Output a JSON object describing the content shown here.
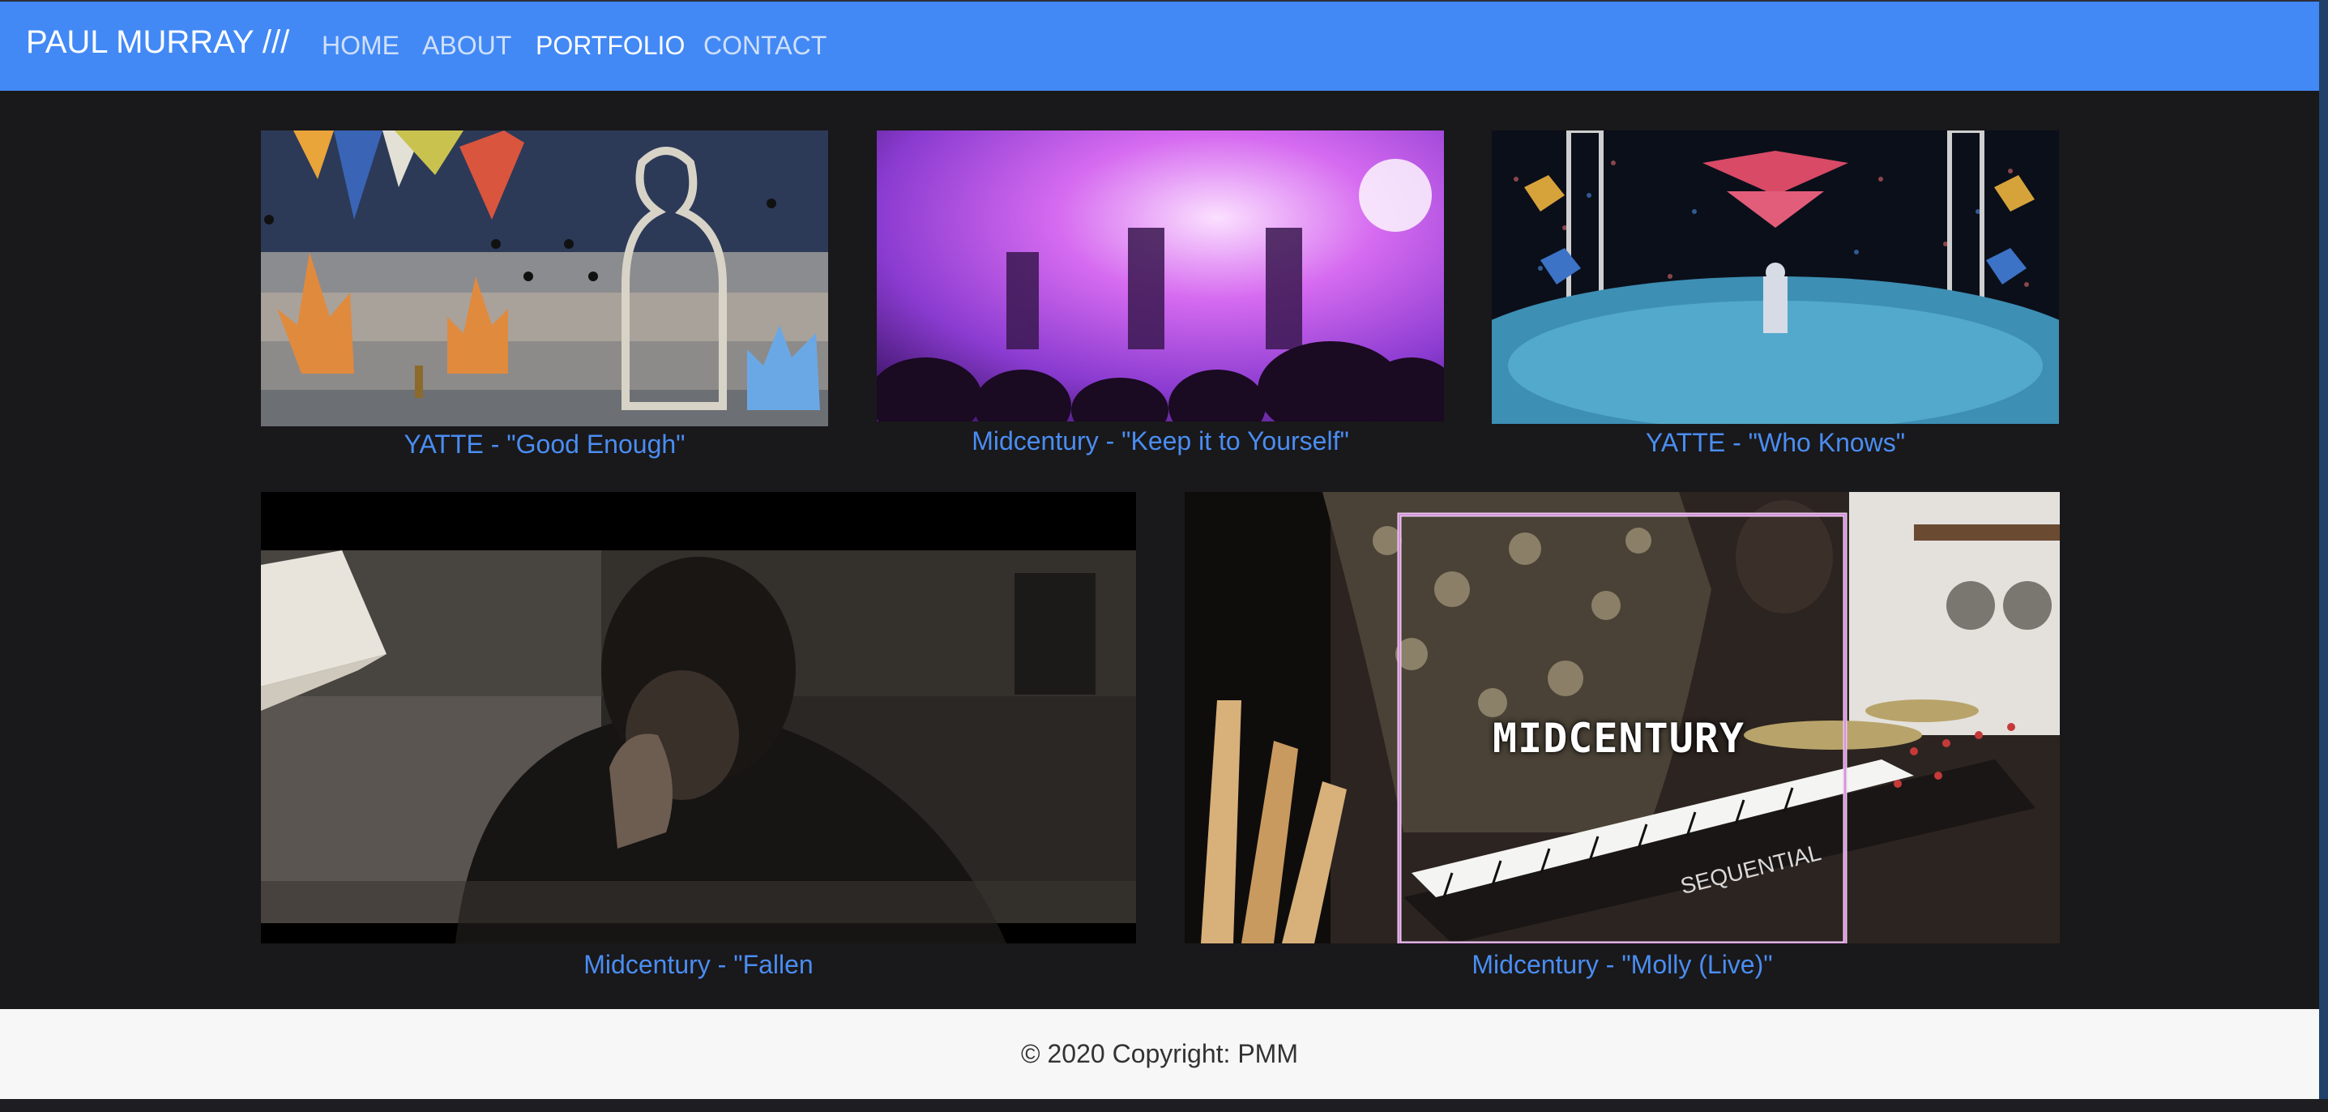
{
  "nav": {
    "brand": "PAUL MURRAY ///",
    "links": [
      {
        "label": "HOME",
        "active": false
      },
      {
        "label": "ABOUT",
        "active": false
      },
      {
        "label": "PORTFOLIO",
        "active": true
      },
      {
        "label": "CONTACT",
        "active": false
      }
    ]
  },
  "videos": [
    {
      "title": "YATTE - \"Good Enough\""
    },
    {
      "title": "Midcentury - \"Keep it to Yourself\""
    },
    {
      "title": "YATTE - \"Who Knows\""
    },
    {
      "title": "Midcentury - \"Fallen"
    },
    {
      "title": "Midcentury - \"Molly (Live)\"",
      "overlay_text": "MIDCENTURY",
      "keyboard_text": "SEQUENTIAL"
    }
  ],
  "footer": {
    "copyright": "© 2020 Copyright: PMM"
  },
  "colors": {
    "navbar": "#4289f5",
    "background": "#19181a",
    "link": "#4a8df2",
    "footer_bg": "#f7f7f7"
  }
}
